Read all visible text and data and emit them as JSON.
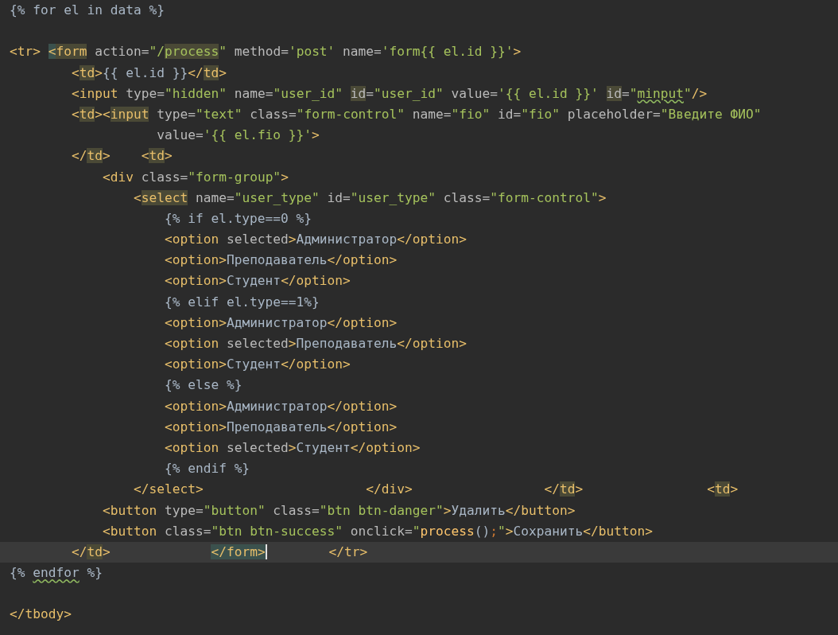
{
  "editor": {
    "lines": [
      {
        "current": false,
        "tokens": [
          {
            "kind": "text",
            "text": "{% for el in data %}"
          }
        ]
      },
      {
        "current": false
      },
      {
        "current": false,
        "tokens": [
          {
            "kind": "tag",
            "text": "<tr> "
          },
          {
            "kind": "tag",
            "text": "<",
            "match": true
          },
          {
            "kind": "tag",
            "text": "form",
            "usage": true
          },
          {
            "kind": "attr",
            "text": " action="
          },
          {
            "kind": "string",
            "text": "\"/"
          },
          {
            "kind": "string",
            "text": "process",
            "usage": true
          },
          {
            "kind": "string",
            "text": "\""
          },
          {
            "kind": "attr",
            "text": " method="
          },
          {
            "kind": "string",
            "text": "'post'"
          },
          {
            "kind": "attr",
            "text": " name="
          },
          {
            "kind": "string",
            "text": "'form{{ el.id }}'"
          },
          {
            "kind": "tag",
            "text": ">"
          }
        ]
      },
      {
        "current": false,
        "tokens": [
          {
            "kind": "tag",
            "text": "        <"
          },
          {
            "kind": "tag",
            "text": "td",
            "usage": true
          },
          {
            "kind": "tag",
            "text": ">"
          },
          {
            "kind": "text",
            "text": "{{ el.id }}"
          },
          {
            "kind": "tag",
            "text": "</"
          },
          {
            "kind": "tag",
            "text": "td",
            "usage": true
          },
          {
            "kind": "tag",
            "text": ">"
          }
        ]
      },
      {
        "current": false,
        "tokens": [
          {
            "kind": "tag",
            "text": "        <input"
          },
          {
            "kind": "attr",
            "text": " type="
          },
          {
            "kind": "string",
            "text": "\"hidden\""
          },
          {
            "kind": "attr",
            "text": " name="
          },
          {
            "kind": "string",
            "text": "\"user_id\" "
          },
          {
            "kind": "attr",
            "text": "id",
            "usage": true
          },
          {
            "kind": "attr",
            "text": "="
          },
          {
            "kind": "string",
            "text": "\"user_id\""
          },
          {
            "kind": "attr",
            "text": " value="
          },
          {
            "kind": "string",
            "text": "'{{ el.id }}' "
          },
          {
            "kind": "attr",
            "text": "id",
            "usage": true
          },
          {
            "kind": "attr",
            "text": "="
          },
          {
            "kind": "string",
            "text": "\""
          },
          {
            "kind": "string",
            "text": "minput",
            "typo": true
          },
          {
            "kind": "string",
            "text": "\""
          },
          {
            "kind": "tag",
            "text": "/>"
          }
        ]
      },
      {
        "current": false,
        "tokens": [
          {
            "kind": "tag",
            "text": "        <"
          },
          {
            "kind": "tag",
            "text": "td",
            "usage": true
          },
          {
            "kind": "tag",
            "text": "><"
          },
          {
            "kind": "tag",
            "text": "input",
            "usage": true
          },
          {
            "kind": "attr",
            "text": " type="
          },
          {
            "kind": "string",
            "text": "\"text\""
          },
          {
            "kind": "attr",
            "text": " class="
          },
          {
            "kind": "string",
            "text": "\"form-control\""
          },
          {
            "kind": "attr",
            "text": " name="
          },
          {
            "kind": "string",
            "text": "\"fio\""
          },
          {
            "kind": "attr",
            "text": " id="
          },
          {
            "kind": "string",
            "text": "\"fio\""
          },
          {
            "kind": "attr",
            "text": " placeholder="
          },
          {
            "kind": "string",
            "text": "\"Введите ФИО\""
          }
        ]
      },
      {
        "current": false,
        "tokens": [
          {
            "kind": "attr",
            "text": "                   value="
          },
          {
            "kind": "string",
            "text": "'{{ el.fio }}'"
          },
          {
            "kind": "tag",
            "text": ">"
          }
        ]
      },
      {
        "current": false,
        "tokens": [
          {
            "kind": "tag",
            "text": "        </"
          },
          {
            "kind": "tag",
            "text": "td",
            "usage": true
          },
          {
            "kind": "tag",
            "text": ">    <"
          },
          {
            "kind": "tag",
            "text": "td",
            "usage": true
          },
          {
            "kind": "tag",
            "text": ">"
          }
        ]
      },
      {
        "current": false,
        "tokens": [
          {
            "kind": "tag",
            "text": "            <div"
          },
          {
            "kind": "attr",
            "text": " class="
          },
          {
            "kind": "string",
            "text": "\"form-group\""
          },
          {
            "kind": "tag",
            "text": ">"
          }
        ]
      },
      {
        "current": false,
        "tokens": [
          {
            "kind": "tag",
            "text": "                <"
          },
          {
            "kind": "tag",
            "text": "select",
            "usage": true
          },
          {
            "kind": "attr",
            "text": " name="
          },
          {
            "kind": "string",
            "text": "\"user_type\""
          },
          {
            "kind": "attr",
            "text": " id="
          },
          {
            "kind": "string",
            "text": "\"user_type\""
          },
          {
            "kind": "attr",
            "text": " class="
          },
          {
            "kind": "string",
            "text": "\"form-control\""
          },
          {
            "kind": "tag",
            "text": ">"
          }
        ]
      },
      {
        "current": false,
        "tokens": [
          {
            "kind": "text",
            "text": "                    {% if el.type==0 %}"
          }
        ]
      },
      {
        "current": false,
        "tokens": [
          {
            "kind": "tag",
            "text": "                    <option"
          },
          {
            "kind": "attr",
            "text": " selected"
          },
          {
            "kind": "tag",
            "text": ">"
          },
          {
            "kind": "text",
            "text": "Администратор"
          },
          {
            "kind": "tag",
            "text": "</option>"
          }
        ]
      },
      {
        "current": false,
        "tokens": [
          {
            "kind": "tag",
            "text": "                    <option>"
          },
          {
            "kind": "text",
            "text": "Преподаватель"
          },
          {
            "kind": "tag",
            "text": "</option>"
          }
        ]
      },
      {
        "current": false,
        "tokens": [
          {
            "kind": "tag",
            "text": "                    <option>"
          },
          {
            "kind": "text",
            "text": "Студент"
          },
          {
            "kind": "tag",
            "text": "</option>"
          }
        ]
      },
      {
        "current": false,
        "tokens": [
          {
            "kind": "text",
            "text": "                    {% elif el.type==1%}"
          }
        ]
      },
      {
        "current": false,
        "tokens": [
          {
            "kind": "tag",
            "text": "                    <option>"
          },
          {
            "kind": "text",
            "text": "Администратор"
          },
          {
            "kind": "tag",
            "text": "</option>"
          }
        ]
      },
      {
        "current": false,
        "tokens": [
          {
            "kind": "tag",
            "text": "                    <option"
          },
          {
            "kind": "attr",
            "text": " selected"
          },
          {
            "kind": "tag",
            "text": ">"
          },
          {
            "kind": "text",
            "text": "Преподаватель"
          },
          {
            "kind": "tag",
            "text": "</option>"
          }
        ]
      },
      {
        "current": false,
        "tokens": [
          {
            "kind": "tag",
            "text": "                    <option>"
          },
          {
            "kind": "text",
            "text": "Студент"
          },
          {
            "kind": "tag",
            "text": "</option>"
          }
        ]
      },
      {
        "current": false,
        "tokens": [
          {
            "kind": "text",
            "text": "                    {% else %}"
          }
        ]
      },
      {
        "current": false,
        "tokens": [
          {
            "kind": "tag",
            "text": "                    <option>"
          },
          {
            "kind": "text",
            "text": "Администратор"
          },
          {
            "kind": "tag",
            "text": "</option>"
          }
        ]
      },
      {
        "current": false,
        "tokens": [
          {
            "kind": "tag",
            "text": "                    <option>"
          },
          {
            "kind": "text",
            "text": "Преподаватель"
          },
          {
            "kind": "tag",
            "text": "</option>"
          }
        ]
      },
      {
        "current": false,
        "tokens": [
          {
            "kind": "tag",
            "text": "                    <option"
          },
          {
            "kind": "attr",
            "text": " selected"
          },
          {
            "kind": "tag",
            "text": ">"
          },
          {
            "kind": "text",
            "text": "Студент"
          },
          {
            "kind": "tag",
            "text": "</option>"
          }
        ]
      },
      {
        "current": false,
        "tokens": [
          {
            "kind": "text",
            "text": "                    {% endif %}"
          }
        ]
      },
      {
        "current": false,
        "tokens": [
          {
            "kind": "tag",
            "text": "                </select>                     </div>                 </"
          },
          {
            "kind": "tag",
            "text": "td",
            "usage": true
          },
          {
            "kind": "tag",
            "text": ">                <"
          },
          {
            "kind": "tag",
            "text": "td",
            "usage": true
          },
          {
            "kind": "tag",
            "text": ">"
          }
        ]
      },
      {
        "current": false,
        "tokens": [
          {
            "kind": "tag",
            "text": "            <button"
          },
          {
            "kind": "attr",
            "text": " type="
          },
          {
            "kind": "string",
            "text": "\"button\""
          },
          {
            "kind": "attr",
            "text": " class="
          },
          {
            "kind": "string",
            "text": "\"btn btn-danger\""
          },
          {
            "kind": "tag",
            "text": ">"
          },
          {
            "kind": "text",
            "text": "Удалить"
          },
          {
            "kind": "tag",
            "text": "</button>"
          }
        ]
      },
      {
        "current": false,
        "tokens": [
          {
            "kind": "tag",
            "text": "            <button"
          },
          {
            "kind": "attr",
            "text": " class="
          },
          {
            "kind": "string",
            "text": "\"btn btn-success\""
          },
          {
            "kind": "attr",
            "text": " onclick="
          },
          {
            "kind": "string",
            "text": "\""
          },
          {
            "kind": "function",
            "text": "process"
          },
          {
            "kind": "text",
            "text": "()"
          },
          {
            "kind": "punct",
            "text": ";"
          },
          {
            "kind": "string",
            "text": "\""
          },
          {
            "kind": "tag",
            "text": ">"
          },
          {
            "kind": "text",
            "text": "Сохранить"
          },
          {
            "kind": "tag",
            "text": "</button>"
          }
        ]
      },
      {
        "current": true,
        "tokens": [
          {
            "kind": "tag",
            "text": "        </"
          },
          {
            "kind": "tag",
            "text": "td",
            "usage": true
          },
          {
            "kind": "tag",
            "text": ">             "
          },
          {
            "kind": "tag",
            "text": "</form>",
            "match": true,
            "cursor": true
          },
          {
            "kind": "tag",
            "text": "        </tr>"
          }
        ]
      },
      {
        "current": false,
        "tokens": [
          {
            "kind": "text",
            "text": "{% "
          },
          {
            "kind": "text",
            "text": "endfor",
            "typo": true
          },
          {
            "kind": "text",
            "text": " %}"
          }
        ]
      },
      {
        "current": false
      },
      {
        "current": false,
        "tokens": [
          {
            "kind": "tag",
            "text": "</tbody>"
          }
        ]
      }
    ]
  }
}
